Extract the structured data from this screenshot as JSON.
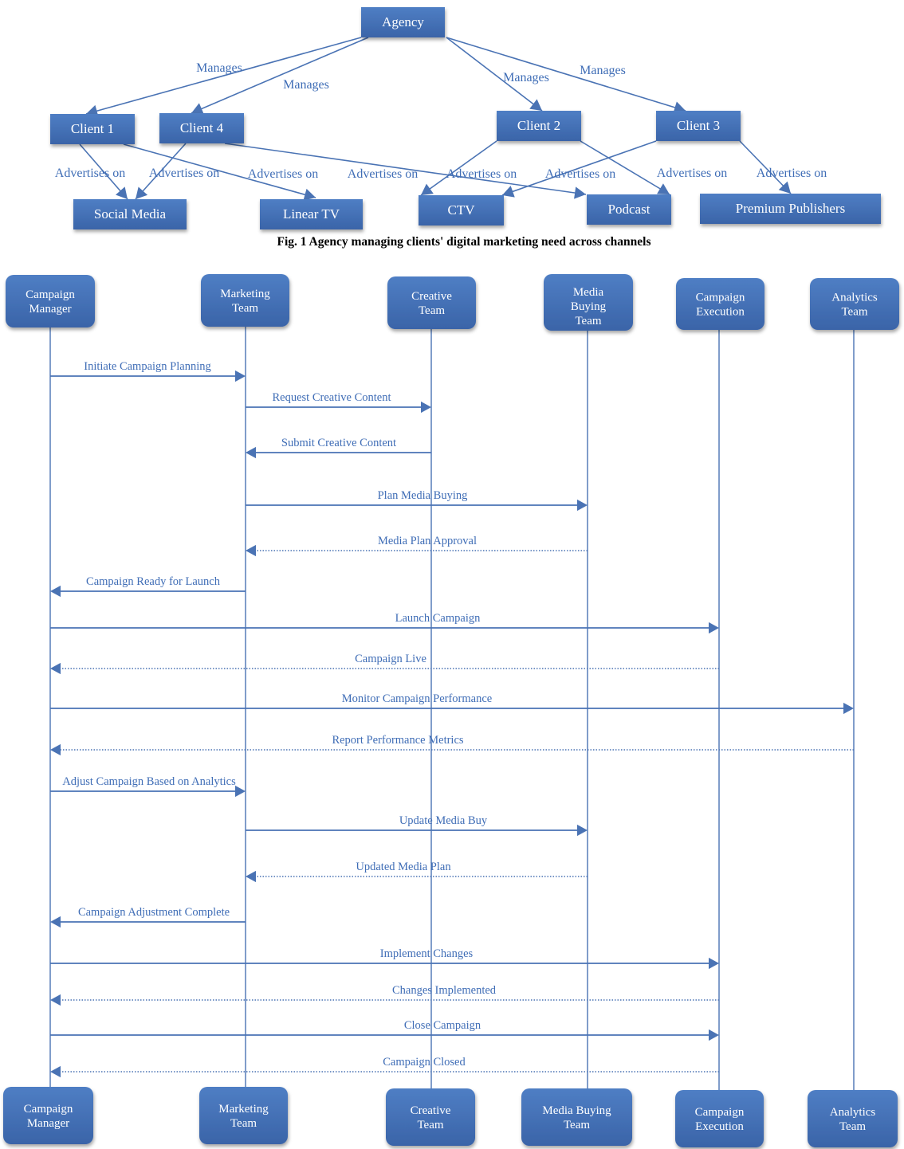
{
  "figure1": {
    "caption": "Fig. 1 Agency managing clients' digital marketing need across channels",
    "nodes": [
      {
        "id": "agency",
        "label": "Agency"
      },
      {
        "id": "client1",
        "label": "Client 1"
      },
      {
        "id": "client4",
        "label": "Client 4"
      },
      {
        "id": "client2",
        "label": "Client 2"
      },
      {
        "id": "client3",
        "label": "Client 3"
      },
      {
        "id": "social",
        "label": "Social Media"
      },
      {
        "id": "lineartv",
        "label": "Linear TV"
      },
      {
        "id": "ctv",
        "label": "CTV"
      },
      {
        "id": "podcast",
        "label": "Podcast"
      },
      {
        "id": "premium",
        "label": "Premium Publishers"
      }
    ],
    "edges": [
      {
        "from": "agency",
        "to": "client1",
        "label": "Manages"
      },
      {
        "from": "agency",
        "to": "client4",
        "label": "Manages"
      },
      {
        "from": "agency",
        "to": "client2",
        "label": "Manages"
      },
      {
        "from": "agency",
        "to": "client3",
        "label": "Manages"
      },
      {
        "from": "client1",
        "to": "social",
        "label": "Advertises on"
      },
      {
        "from": "client4",
        "to": "social",
        "label": "Advertises on"
      },
      {
        "from": "client1",
        "to": "lineartv",
        "label": "Advertises on"
      },
      {
        "from": "client4",
        "to": "podcast",
        "label": "Advertises on"
      },
      {
        "from": "client2",
        "to": "ctv",
        "label": "Advertises on"
      },
      {
        "from": "client3",
        "to": "ctv",
        "label": "Advertises on"
      },
      {
        "from": "client2",
        "to": "podcast",
        "label": "Advertises on"
      },
      {
        "from": "client3",
        "to": "premium",
        "label": "Advertises on"
      }
    ]
  },
  "sequence": {
    "actors": [
      {
        "id": "cm",
        "top_label": [
          "Campaign",
          "Manager"
        ],
        "bottom_label": [
          "Campaign",
          "Manager"
        ]
      },
      {
        "id": "mt",
        "top_label": [
          "Marketing",
          "Team"
        ],
        "bottom_label": [
          "Marketing",
          "Team"
        ]
      },
      {
        "id": "ct",
        "top_label": [
          "Creative",
          "Team"
        ],
        "bottom_label": [
          "Creative",
          "Team"
        ]
      },
      {
        "id": "mb",
        "top_label": [
          "Media",
          "Buying",
          "Team"
        ],
        "bottom_label": [
          "Media Buying",
          "Team"
        ]
      },
      {
        "id": "ce",
        "top_label": [
          "Campaign",
          "Execution"
        ],
        "bottom_label": [
          "Campaign",
          "Execution"
        ]
      },
      {
        "id": "at",
        "top_label": [
          "Analytics",
          "Team"
        ],
        "bottom_label": [
          "Analytics",
          "Team"
        ]
      }
    ],
    "messages": [
      {
        "from": "cm",
        "to": "mt",
        "label": "Initiate Campaign Planning",
        "style": "solid"
      },
      {
        "from": "mt",
        "to": "ct",
        "label": "Request Creative Content",
        "style": "solid"
      },
      {
        "from": "ct",
        "to": "mt",
        "label": "Submit Creative Content",
        "style": "solid"
      },
      {
        "from": "mt",
        "to": "mb",
        "label": "Plan Media Buying",
        "style": "solid"
      },
      {
        "from": "mb",
        "to": "mt",
        "label": "Media Plan Approval",
        "style": "dotted"
      },
      {
        "from": "mt",
        "to": "cm",
        "label": "Campaign Ready for Launch",
        "style": "solid"
      },
      {
        "from": "cm",
        "to": "ce",
        "label": "Launch Campaign",
        "style": "solid"
      },
      {
        "from": "ce",
        "to": "cm",
        "label": "Campaign Live",
        "style": "dotted"
      },
      {
        "from": "cm",
        "to": "at",
        "label": "Monitor Campaign Performance",
        "style": "solid"
      },
      {
        "from": "at",
        "to": "cm",
        "label": "Report Performance Metrics",
        "style": "dotted"
      },
      {
        "from": "cm",
        "to": "mt",
        "label": "Adjust Campaign Based on Analytics",
        "style": "solid"
      },
      {
        "from": "mt",
        "to": "mb",
        "label": "Update Media Buy",
        "style": "solid"
      },
      {
        "from": "mb",
        "to": "mt",
        "label": "Updated Media Plan",
        "style": "dotted"
      },
      {
        "from": "mt",
        "to": "cm",
        "label": "Campaign Adjustment Complete",
        "style": "solid"
      },
      {
        "from": "cm",
        "to": "ce",
        "label": "Implement Changes",
        "style": "solid"
      },
      {
        "from": "ce",
        "to": "cm",
        "label": "Changes Implemented",
        "style": "dotted"
      },
      {
        "from": "cm",
        "to": "ce",
        "label": "Close Campaign",
        "style": "solid"
      },
      {
        "from": "ce",
        "to": "cm",
        "label": "Campaign Closed",
        "style": "dotted"
      }
    ]
  },
  "colors": {
    "box_top": "#4f7ec4",
    "box_bottom": "#3a64a8",
    "line": "#4a73b4",
    "label": "#3f6db6"
  }
}
